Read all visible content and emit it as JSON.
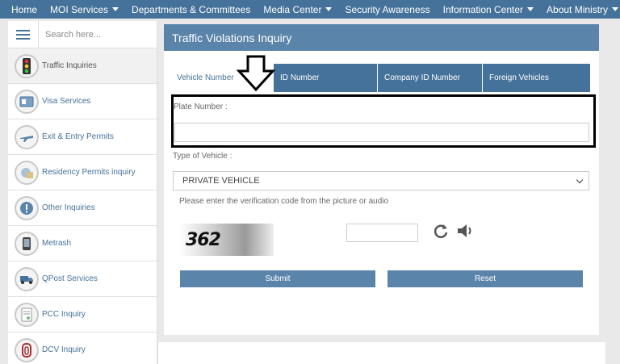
{
  "topnav": {
    "items": [
      {
        "label": "Home",
        "dropdown": false
      },
      {
        "label": "MOI Services",
        "dropdown": true
      },
      {
        "label": "Departments & Committees",
        "dropdown": false
      },
      {
        "label": "Media Center",
        "dropdown": true
      },
      {
        "label": "Security Awareness",
        "dropdown": false
      },
      {
        "label": "Information Center",
        "dropdown": true
      },
      {
        "label": "About Ministry",
        "dropdown": true
      }
    ]
  },
  "sidebar": {
    "search_placeholder": "Search here...",
    "items": [
      {
        "label": "Traffic Inquiries",
        "icon": "traffic-light-icon",
        "active": true
      },
      {
        "label": "Visa Services",
        "icon": "passport-icon",
        "active": false
      },
      {
        "label": "Exit & Entry Permits",
        "icon": "airplane-icon",
        "active": false
      },
      {
        "label": "Residency Permits inquiry",
        "icon": "residency-card-icon",
        "active": false
      },
      {
        "label": "Other Inquiries",
        "icon": "exclamation-icon",
        "active": false
      },
      {
        "label": "Metrash",
        "icon": "phone-icon",
        "active": false
      },
      {
        "label": "QPost Services",
        "icon": "truck-icon",
        "active": false
      },
      {
        "label": "PCC Inquiry",
        "icon": "certificate-icon",
        "active": false
      },
      {
        "label": "DCV Inquiry",
        "icon": "document-icon",
        "active": false
      }
    ]
  },
  "main": {
    "title": "Traffic Violations Inquiry",
    "tabs": [
      {
        "label": "Vehicle Number",
        "active": true
      },
      {
        "label": "ID Number",
        "active": false
      },
      {
        "label": "Company ID Number",
        "active": false
      },
      {
        "label": "Foreign Vehicles",
        "active": false
      }
    ],
    "plate_label": "Plate Number :",
    "plate_value": "",
    "vehicle_type_label": "Type of Vehicle :",
    "vehicle_type_value": "PRIVATE VEHICLE",
    "verification_text": "Please enter the verification code from the picture or audio",
    "captcha_code": "362",
    "captcha_input_value": "",
    "submit_label": "Submit",
    "reset_label": "Reset"
  },
  "colors": {
    "nav_bg": "#44729a",
    "panel_title_bg": "#5b84aa",
    "button_bg": "#5b84aa",
    "highlight_border": "#000000"
  }
}
